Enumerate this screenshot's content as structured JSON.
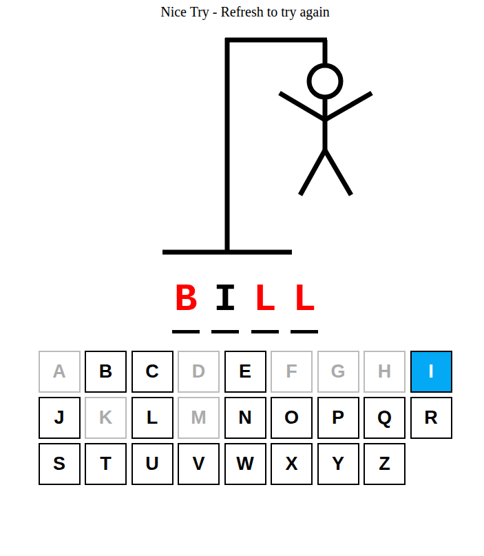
{
  "status": {
    "message": "Nice Try - Refresh to try again"
  },
  "hangman": {
    "parts_shown": 6
  },
  "word": [
    {
      "char": "B",
      "guessed": false
    },
    {
      "char": "I",
      "guessed": true
    },
    {
      "char": "L",
      "guessed": false
    },
    {
      "char": "L",
      "guessed": false
    }
  ],
  "keyboard": [
    {
      "letter": "A",
      "disabled": true,
      "selected": false
    },
    {
      "letter": "B",
      "disabled": false,
      "selected": false
    },
    {
      "letter": "C",
      "disabled": false,
      "selected": false
    },
    {
      "letter": "D",
      "disabled": true,
      "selected": false
    },
    {
      "letter": "E",
      "disabled": false,
      "selected": false
    },
    {
      "letter": "F",
      "disabled": true,
      "selected": false
    },
    {
      "letter": "G",
      "disabled": true,
      "selected": false
    },
    {
      "letter": "H",
      "disabled": true,
      "selected": false
    },
    {
      "letter": "I",
      "disabled": false,
      "selected": true
    },
    {
      "letter": "J",
      "disabled": false,
      "selected": false
    },
    {
      "letter": "K",
      "disabled": true,
      "selected": false
    },
    {
      "letter": "L",
      "disabled": false,
      "selected": false
    },
    {
      "letter": "M",
      "disabled": true,
      "selected": false
    },
    {
      "letter": "N",
      "disabled": false,
      "selected": false
    },
    {
      "letter": "O",
      "disabled": false,
      "selected": false
    },
    {
      "letter": "P",
      "disabled": false,
      "selected": false
    },
    {
      "letter": "Q",
      "disabled": false,
      "selected": false
    },
    {
      "letter": "R",
      "disabled": false,
      "selected": false
    },
    {
      "letter": "S",
      "disabled": false,
      "selected": false
    },
    {
      "letter": "T",
      "disabled": false,
      "selected": false
    },
    {
      "letter": "U",
      "disabled": false,
      "selected": false
    },
    {
      "letter": "V",
      "disabled": false,
      "selected": false
    },
    {
      "letter": "W",
      "disabled": false,
      "selected": false
    },
    {
      "letter": "X",
      "disabled": false,
      "selected": false
    },
    {
      "letter": "Y",
      "disabled": false,
      "selected": false
    },
    {
      "letter": "Z",
      "disabled": false,
      "selected": false
    }
  ]
}
